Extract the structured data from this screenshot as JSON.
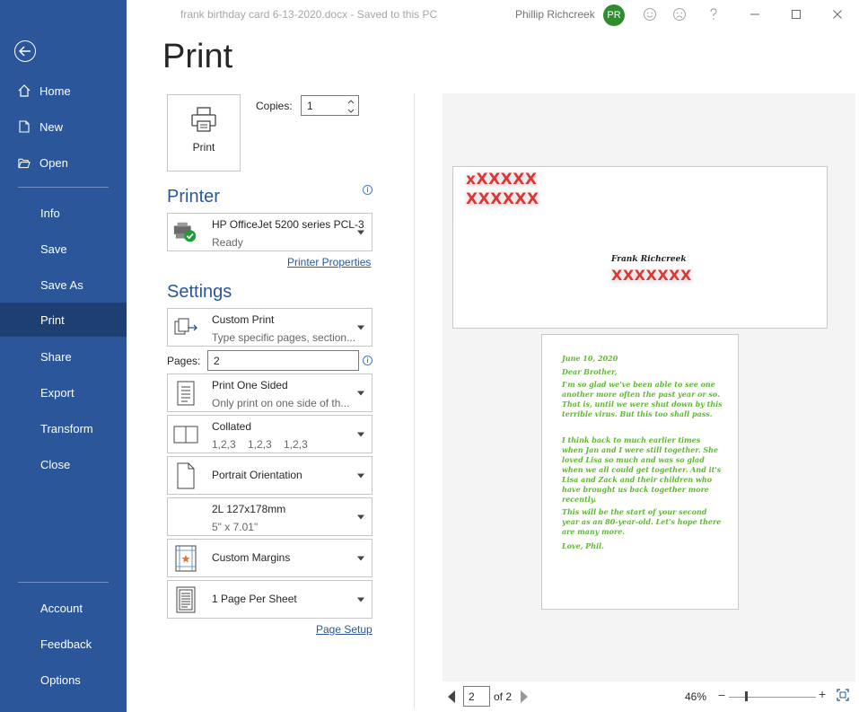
{
  "titlebar": {
    "doc_title": "frank birthday card 6-13-2020.docx  -  Saved to this PC",
    "user_name": "Phillip Richcreek",
    "avatar_initials": "PR"
  },
  "sidebar": {
    "home": "Home",
    "new": "New",
    "open": "Open",
    "info": "Info",
    "save": "Save",
    "save_as": "Save As",
    "print": "Print",
    "share": "Share",
    "export": "Export",
    "transform": "Transform",
    "close": "Close",
    "account": "Account",
    "feedback": "Feedback",
    "options": "Options"
  },
  "print": {
    "title": "Print",
    "print_button": "Print",
    "copies_label": "Copies:",
    "copies_value": "1"
  },
  "printer": {
    "heading": "Printer",
    "name": "HP OfficeJet 5200 series PCL-3",
    "status": "Ready",
    "properties_link": "Printer Properties"
  },
  "settings": {
    "heading": "Settings",
    "print_range": {
      "title": "Custom Print",
      "subtitle": "Type specific pages, section..."
    },
    "pages_label": "Pages:",
    "pages_value": "2",
    "sides": {
      "title": "Print One Sided",
      "subtitle": "Only print on one side of th..."
    },
    "collation": {
      "title": "Collated",
      "subtitle": "1,2,3    1,2,3    1,2,3"
    },
    "orientation": {
      "title": "Portrait Orientation"
    },
    "paper": {
      "title": "2L 127x178mm",
      "subtitle": "5\" x 7.01\""
    },
    "margins": {
      "title": "Custom Margins"
    },
    "per_sheet": {
      "title": "1 Page Per Sheet"
    },
    "page_setup_link": "Page Setup"
  },
  "preview": {
    "envelope_return_1": "xXXXXX",
    "envelope_return_2": "XXXXXX",
    "envelope_name": "Frank Richcreek",
    "envelope_address": "XXXXXXX",
    "letter_date": "June 10, 2020",
    "letter_greeting": "Dear Brother,",
    "letter_p1": "I'm so glad we've been able to see one another more often the past year or so. That is, until we were shut down by this terrible virus. But this too shall pass.",
    "letter_p2": "I think back to much earlier times when Jan and I were still together. She loved Lisa so much and was so glad when we all could get together. And it's Lisa and Zack and their children who have brought us back together more recently.",
    "letter_p3": "This will be the start of your second year as an 80-year-old. Let's hope there are many more.",
    "letter_sign": "Love, Phil."
  },
  "pager": {
    "current_page": "2",
    "of_label": "of 2",
    "zoom": "46%"
  },
  "colors": {
    "sidebar": "#2b579a",
    "sidebar_active": "#1e3f72",
    "accent": "#2b579a",
    "redacted": "#e03535",
    "letter_text": "#5fb832"
  }
}
